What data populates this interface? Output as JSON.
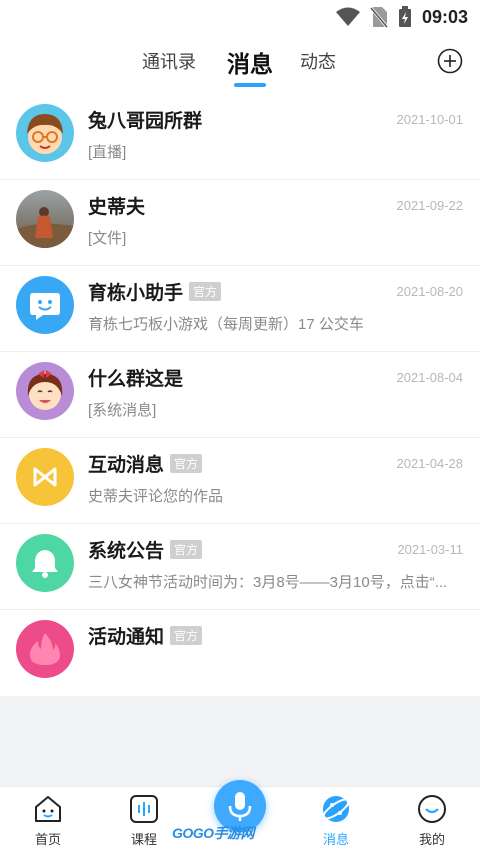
{
  "status_bar": {
    "time": "09:03"
  },
  "header": {
    "tabs": [
      {
        "label": "通讯录",
        "active": false
      },
      {
        "label": "消息",
        "active": true
      },
      {
        "label": "动态",
        "active": false
      }
    ]
  },
  "messages": [
    {
      "name": "兔八哥园所群",
      "badge": "",
      "date": "2021-10-01",
      "preview": "[直播]",
      "avatar": "boy-glasses-avatar"
    },
    {
      "name": "史蒂夫",
      "badge": "",
      "date": "2021-09-22",
      "preview": "[文件]",
      "avatar": "photo-avatar"
    },
    {
      "name": "育栋小助手",
      "badge": "官方",
      "date": "2021-08-20",
      "preview": "育栋七巧板小游戏（每周更新）17 公交车",
      "avatar": "assistant-smile-avatar"
    },
    {
      "name": "什么群这是",
      "badge": "",
      "date": "2021-08-04",
      "preview": "[系统消息]",
      "avatar": "girl-avatar"
    },
    {
      "name": "互动消息",
      "badge": "官方",
      "date": "2021-04-28",
      "preview": "史蒂夫评论您的作品",
      "avatar": "interaction-avatar"
    },
    {
      "name": "系统公告",
      "badge": "官方",
      "date": "2021-03-11",
      "preview": "三八女神节活动时间为：3月8号——3月10号，点击“...",
      "avatar": "bell-avatar"
    },
    {
      "name": "活动通知",
      "badge": "官方",
      "date": "",
      "preview": "",
      "avatar": "hot-avatar"
    }
  ],
  "bottom_nav": {
    "items": [
      {
        "label": "首页",
        "icon": "home-face-icon",
        "active": false
      },
      {
        "label": "课程",
        "icon": "course-icon",
        "active": false
      },
      {
        "label": "消息",
        "icon": "message-planet-icon",
        "active": true
      },
      {
        "label": "我的",
        "icon": "profile-face-icon",
        "active": false
      }
    ],
    "mic_icon": "microphone-icon",
    "watermark": "GOGO手游网"
  },
  "colors": {
    "accent": "#2aa3ff",
    "badge_bg": "#cfcfcf"
  }
}
